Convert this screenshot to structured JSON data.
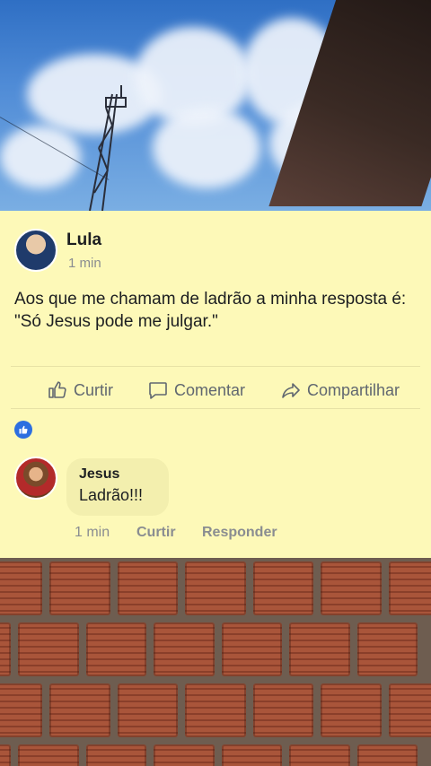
{
  "post": {
    "author": "Lula",
    "time": "1 min",
    "text": "Aos que me chamam de ladrão a minha resposta é: \"Só Jesus pode me julgar.\""
  },
  "actions": {
    "like": "Curtir",
    "comment": "Comentar",
    "share": "Compartilhar"
  },
  "comment": {
    "author": "Jesus",
    "text": "Ladrão!!!",
    "time": "1 min",
    "like": "Curtir",
    "reply": "Responder"
  },
  "colors": {
    "card_background": "#fdf9b8",
    "like_badge": "#2d6fe0"
  },
  "icons": [
    "thumbs-up-icon",
    "comment-icon",
    "share-icon",
    "like-badge-icon"
  ]
}
